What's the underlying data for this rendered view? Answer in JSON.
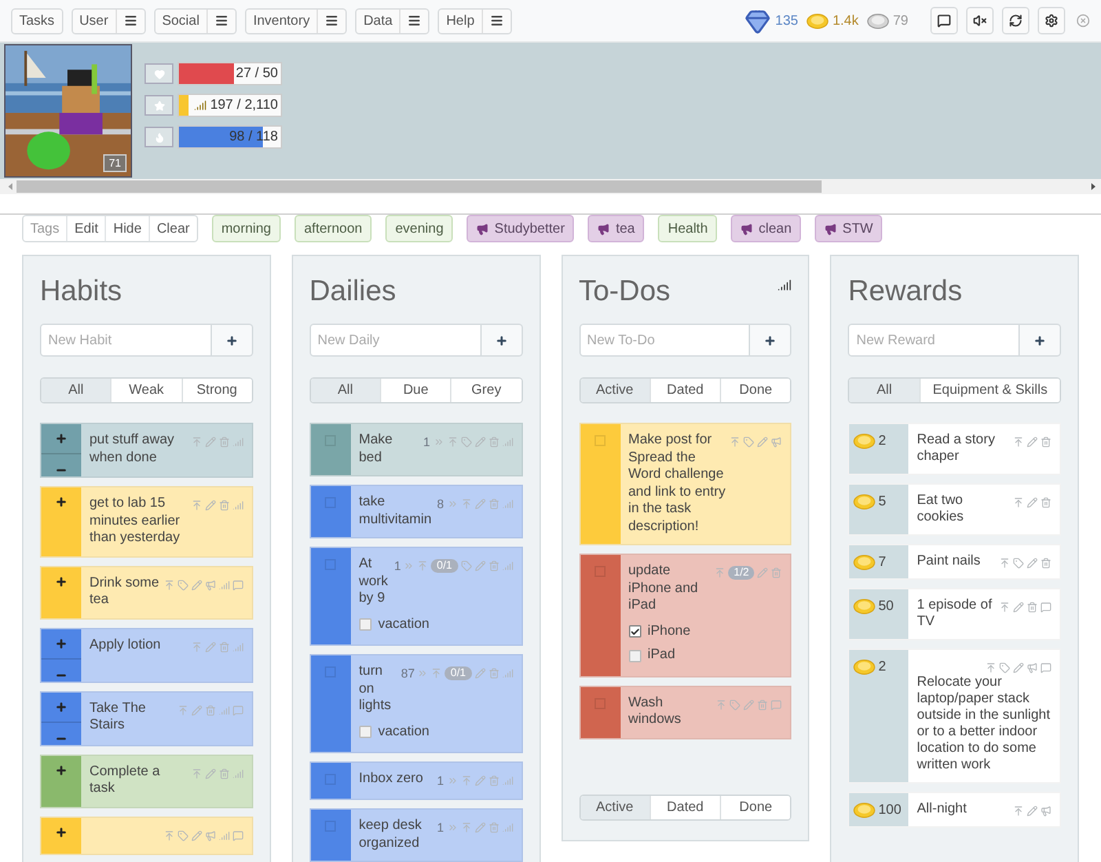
{
  "nav": [
    {
      "label": "Tasks",
      "menu": false
    },
    {
      "label": "User",
      "menu": true
    },
    {
      "label": "Social",
      "menu": true
    },
    {
      "label": "Inventory",
      "menu": true
    },
    {
      "label": "Data",
      "menu": true
    },
    {
      "label": "Help",
      "menu": true
    }
  ],
  "currencies": [
    {
      "kind": "gem",
      "value": "135"
    },
    {
      "kind": "gold",
      "value": "1.4k"
    },
    {
      "kind": "silver",
      "value": "79"
    }
  ],
  "avatar": {
    "level": "71"
  },
  "stats": [
    {
      "kind": "health",
      "reading": "27 / 50",
      "level": 0.54
    },
    {
      "kind": "experience",
      "reading": "197 / 2,110",
      "level": 0.093
    },
    {
      "kind": "mana",
      "reading": "98 / 118",
      "level": 0.83
    }
  ],
  "tag_tools": [
    "Tags",
    "Edit",
    "Hide",
    "Clear"
  ],
  "tags": [
    {
      "label": "morning",
      "challenge": false
    },
    {
      "label": "afternoon",
      "challenge": false
    },
    {
      "label": "evening",
      "challenge": false
    },
    {
      "label": "Studybetter",
      "challenge": true
    },
    {
      "label": "tea",
      "challenge": true
    },
    {
      "label": "Health",
      "challenge": false
    },
    {
      "label": "clean",
      "challenge": true
    },
    {
      "label": "STW",
      "challenge": true
    }
  ],
  "columns": [
    {
      "kind": "habits",
      "title": "Habits",
      "placeholder": "New Habit",
      "filters": [
        {
          "label": "All",
          "selected": true
        },
        {
          "label": "Weak",
          "selected": false
        },
        {
          "label": "Strong",
          "selected": false
        }
      ],
      "tasks": [
        {
          "text": "put stuff away when done",
          "color": "#72a0aa",
          "up": true,
          "down": true,
          "tagged": false,
          "challenge": false,
          "notes": false
        },
        {
          "text": "get to lab 15 minutes earlier than yesterday",
          "color": "#fdcb3c",
          "up": true,
          "down": false,
          "tagged": false,
          "challenge": false,
          "notes": false
        },
        {
          "text": "Drink some tea",
          "color": "#fdcb3c",
          "up": true,
          "down": false,
          "tagged": true,
          "challenge": true,
          "notes": true
        },
        {
          "text": "Apply lotion",
          "color": "#4f85e6",
          "up": true,
          "down": true,
          "tagged": false,
          "challenge": false,
          "notes": false
        },
        {
          "text": "Take The Stairs",
          "color": "#4f85e6",
          "up": true,
          "down": true,
          "tagged": false,
          "challenge": false,
          "notes": true
        },
        {
          "text": "Complete a task",
          "color": "#8ab96c",
          "up": true,
          "down": false,
          "tagged": false,
          "challenge": false,
          "notes": false
        },
        {
          "color": "#fdcb3c",
          "up": true,
          "down": false,
          "tagged": true,
          "challenge": true,
          "notes": true
        }
      ]
    },
    {
      "kind": "dailies",
      "title": "Dailies",
      "placeholder": "New Daily",
      "filters": [
        {
          "label": "All",
          "selected": true
        },
        {
          "label": "Due",
          "selected": false
        },
        {
          "label": "Grey",
          "selected": false
        }
      ],
      "tasks": [
        {
          "text": "Make bed",
          "color": "#7aa6a8",
          "done": false,
          "streak": "1",
          "tagged": true,
          "challenge": false,
          "notes": false
        },
        {
          "text": "take multivitamin",
          "color": "#4f85e6",
          "done": false,
          "streak": "8",
          "tagged": false,
          "challenge": false,
          "notes": false
        },
        {
          "text": "At work by 9",
          "color": "#4f85e6",
          "done": false,
          "streak": "1",
          "progress": "0/1",
          "tagged": true,
          "challenge": false,
          "notes": false,
          "checklist": [
            {
              "label": "vacation",
              "checked": false
            }
          ]
        },
        {
          "text": "turn on lights",
          "color": "#4f85e6",
          "done": false,
          "streak": "87",
          "progress": "0/1",
          "tagged": false,
          "challenge": false,
          "notes": false,
          "checklist": [
            {
              "label": "vacation",
              "checked": false
            }
          ]
        },
        {
          "text": "Inbox zero",
          "color": "#4f85e6",
          "done": false,
          "streak": "1",
          "tagged": false,
          "challenge": false,
          "notes": false
        },
        {
          "text": "keep desk organized",
          "color": "#4f85e6",
          "done": false,
          "streak": "1",
          "tagged": false,
          "challenge": false,
          "notes": false
        }
      ]
    },
    {
      "kind": "todos",
      "title": "To-Dos",
      "placeholder": "New To-Do",
      "filters": [
        {
          "label": "Active",
          "selected": true
        },
        {
          "label": "Dated",
          "selected": false
        },
        {
          "label": "Done",
          "selected": false
        }
      ],
      "bottom_filters": [
        {
          "label": "Active",
          "selected": true
        },
        {
          "label": "Dated",
          "selected": false
        },
        {
          "label": "Done",
          "selected": false
        }
      ],
      "tasks": [
        {
          "text": "Make post for Spread the Word challenge and link to entry in the task description!",
          "color": "#fdcb3c",
          "done": false,
          "tagged": true,
          "challenge": true,
          "notes": false
        },
        {
          "text": "update iPhone and iPad",
          "color": "#d0654f",
          "done": false,
          "progress": "1/2",
          "tagged": false,
          "challenge": false,
          "notes": false,
          "checklist": [
            {
              "label": "iPhone",
              "checked": true
            },
            {
              "label": "iPad",
              "checked": false
            }
          ]
        },
        {
          "text": "Wash windows",
          "color": "#d0654f",
          "done": false,
          "tagged": true,
          "challenge": false,
          "notes": true
        }
      ]
    },
    {
      "kind": "rewards",
      "title": "Rewards",
      "placeholder": "New Reward",
      "filters": [
        {
          "label": "All",
          "selected": true
        },
        {
          "label": "Equipment & Skills",
          "selected": false
        }
      ],
      "tasks": [
        {
          "text": "Read a story chaper",
          "price": "2",
          "tagged": false,
          "challenge": false,
          "notes": false
        },
        {
          "text": "Eat two cookies",
          "price": "5",
          "tagged": false,
          "challenge": false,
          "notes": false
        },
        {
          "text": "Paint nails",
          "price": "7",
          "tagged": true,
          "challenge": false,
          "notes": false
        },
        {
          "text": "1 episode of TV",
          "price": "50",
          "tagged": false,
          "challenge": false,
          "notes": true
        },
        {
          "text": "Relocate your laptop/paper stack outside in the sunlight or to a better indoor location to do some written work",
          "price": "2",
          "tagged": true,
          "challenge": true,
          "notes": true
        },
        {
          "text": "All-night",
          "price": "100",
          "tagged": false,
          "challenge": true,
          "notes": false
        }
      ]
    }
  ]
}
